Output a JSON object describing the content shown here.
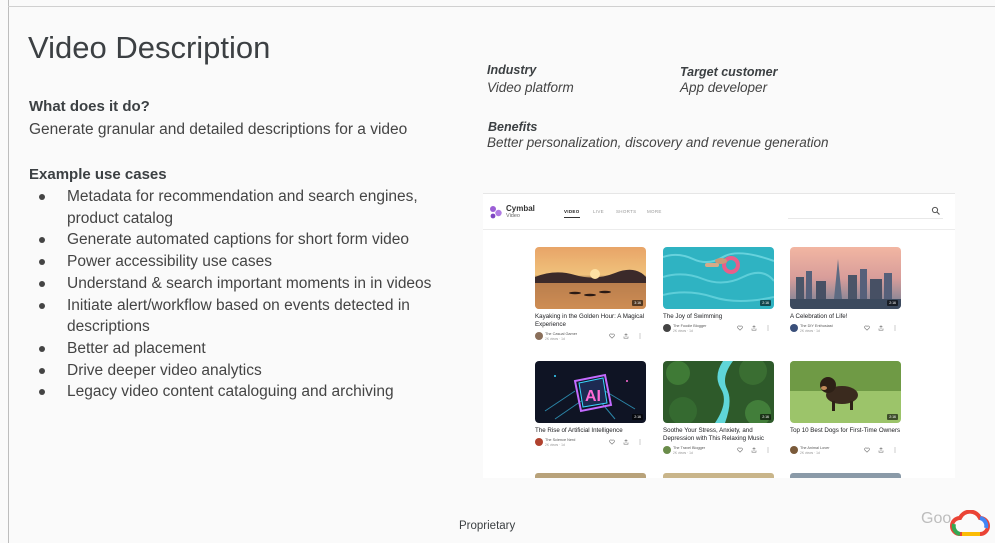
{
  "slide": {
    "title": "Video Description",
    "question_heading": "What does it do?",
    "question_text": "Generate granular and detailed descriptions for a video",
    "usecases_heading": "Example use cases",
    "usecases": [
      "Metadata for recommendation and search engines, product catalog",
      "Generate automated captions for short form video",
      "Power accessibility use cases",
      "Understand  & search important moments in in videos",
      "Initiate alert/workflow based on events detected in descriptions",
      "Better ad placement",
      "Drive deeper video analytics",
      "Legacy video content cataloguing and archiving"
    ],
    "industry_label": "Industry",
    "industry_value": "Video platform",
    "target_label": "Target customer",
    "target_value": "App developer",
    "benefits_label": "Benefits",
    "benefits_value": "Better personalization, discovery and revenue generation",
    "footer": "Proprietary",
    "google_word": "Goo"
  },
  "app": {
    "brand_name": "Cymbal",
    "brand_sub": "Video",
    "tabs": [
      "VIDEO",
      "LIVE",
      "SHORTS",
      "MORE"
    ],
    "active_tab": "VIDEO",
    "videos": [
      {
        "title": "Kayaking in the Golden Hour: A Magical Experience",
        "channel": "The Casual Gamer",
        "views": "2K views · 1d",
        "duration": "3:16",
        "thumb": "sunset"
      },
      {
        "title": "The Joy of Swimming",
        "channel": "The Foodie Blogger",
        "views": "2K views · 1d",
        "duration": "2:16",
        "thumb": "pool"
      },
      {
        "title": "A Celebration of Life!",
        "channel": "The DIY Enthusiast",
        "views": "2K views · 1d",
        "duration": "2:16",
        "thumb": "city"
      },
      {
        "title": "The Rise of Artificial Intelligence",
        "channel": "The Science Nerd",
        "views": "2K views · 1d",
        "duration": "2:16",
        "thumb": "ai"
      },
      {
        "title": "Soothe Your Stress, Anxiety, and Depression with This Relaxing Music",
        "channel": "The Travel Blogger",
        "views": "2K views · 1d",
        "duration": "2:16",
        "thumb": "river"
      },
      {
        "title": "Top 10 Best Dogs for First-Time Owners",
        "channel": "The Animal Lover",
        "views": "2K views · 1d",
        "duration": "2:16",
        "thumb": "dog"
      }
    ]
  },
  "colors": {
    "brand_purple": "#9c5fd6",
    "slide_bg": "#fafafa",
    "text": "#3c4043"
  }
}
